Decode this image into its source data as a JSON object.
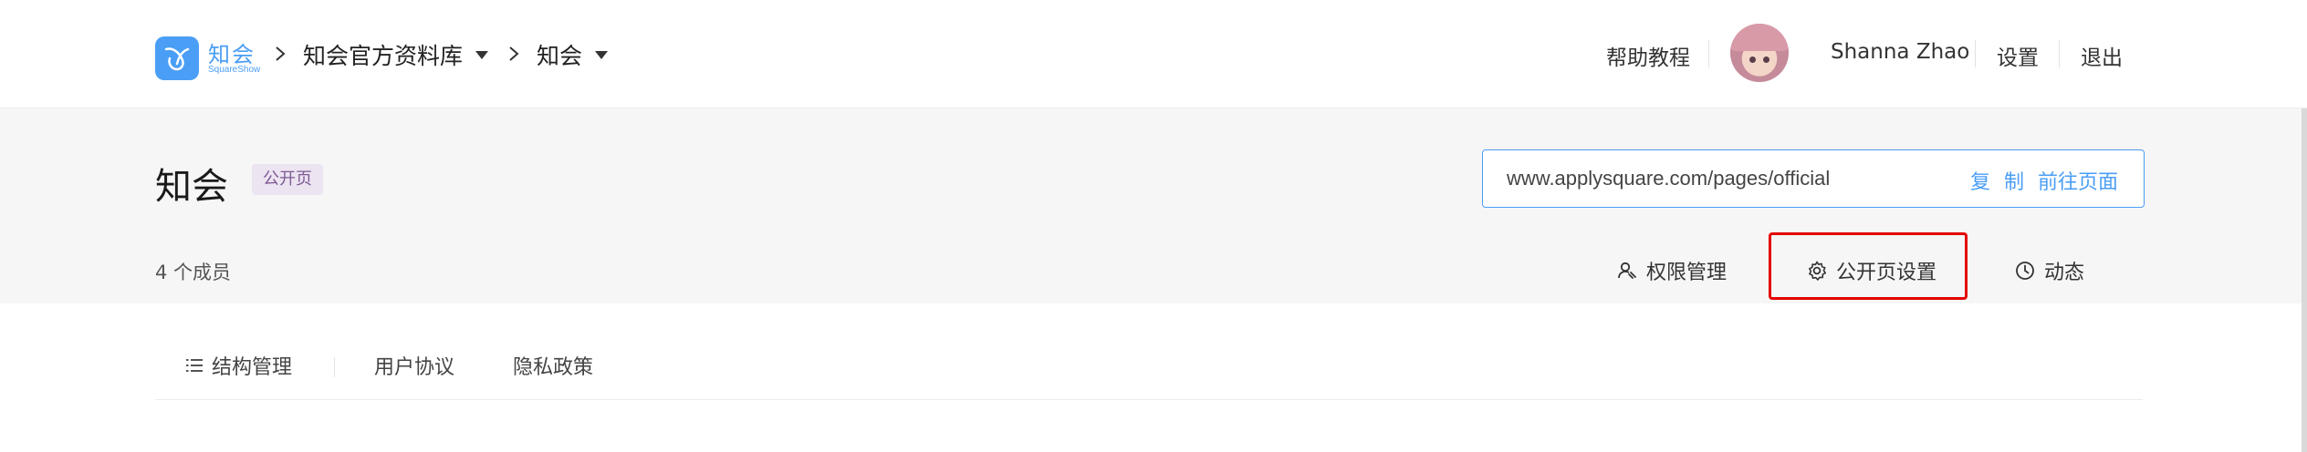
{
  "header": {
    "logo": {
      "wordmark": "知会",
      "subword": "SquareShow"
    },
    "breadcrumb": [
      "知会官方资料库",
      "知会"
    ],
    "help_link": "帮助教程",
    "user_name": "Shanna Zhao",
    "settings_link": "设置",
    "logout_link": "退出"
  },
  "page": {
    "title": "知会",
    "badge": "公开页",
    "url": "www.applysquare.com/pages/official",
    "copy_label": "复 制",
    "goto_label": "前往页面",
    "members": "4 个成员"
  },
  "toolbar": {
    "permissions": "权限管理",
    "public_settings": "公开页设置",
    "activity": "动态"
  },
  "tabs": [
    {
      "label": "结构管理",
      "icon": "list-icon"
    },
    {
      "label": "用户协议"
    },
    {
      "label": "隐私政策"
    }
  ],
  "colors": {
    "accent": "#4a9ef5",
    "badge_bg": "#ece4f1",
    "badge_text": "#7d5a93",
    "highlight": "#e30000",
    "band": "#f6f6f6"
  }
}
